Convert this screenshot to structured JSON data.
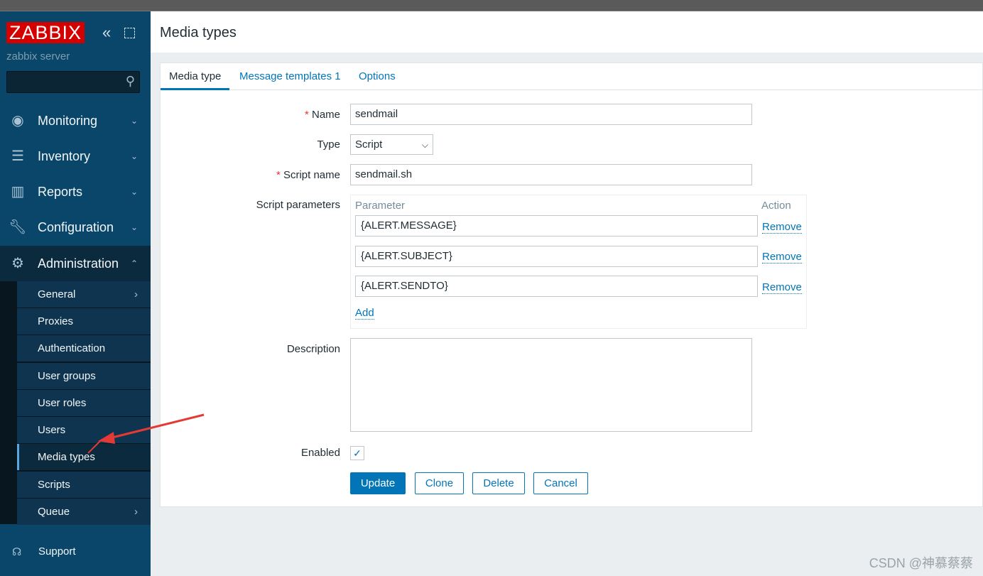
{
  "sidebar": {
    "logo": "ZABBIX",
    "server": "zabbix server",
    "menu": [
      {
        "label": "Monitoring",
        "icon": "eye-icon"
      },
      {
        "label": "Inventory",
        "icon": "list-icon"
      },
      {
        "label": "Reports",
        "icon": "bar-chart-icon"
      },
      {
        "label": "Configuration",
        "icon": "wrench-icon"
      },
      {
        "label": "Administration",
        "icon": "gear-icon"
      }
    ],
    "submenu": [
      "General",
      "Proxies",
      "Authentication",
      "User groups",
      "User roles",
      "Users",
      "Media types",
      "Scripts",
      "Queue"
    ],
    "support": "Support"
  },
  "header": {
    "title": "Media types"
  },
  "tabs": [
    "Media type",
    "Message templates 1",
    "Options"
  ],
  "form": {
    "name_label": "Name",
    "name": "sendmail",
    "type_label": "Type",
    "type": "Script",
    "script_label": "Script name",
    "script": "sendmail.sh",
    "params_label": "Script parameters",
    "param_header": "Parameter",
    "action_header": "Action",
    "params": [
      "{ALERT.MESSAGE}",
      "{ALERT.SUBJECT}",
      "{ALERT.SENDTO}"
    ],
    "remove": "Remove",
    "add": "Add",
    "desc_label": "Description",
    "description": "",
    "enabled_label": "Enabled",
    "enabled": true
  },
  "buttons": {
    "update": "Update",
    "clone": "Clone",
    "delete": "Delete",
    "cancel": "Cancel"
  },
  "watermark": "CSDN @神慕蔡蔡",
  "colors": {
    "accent": "#0275b8",
    "sidebar": "#0a466a",
    "logo": "#d40000"
  }
}
